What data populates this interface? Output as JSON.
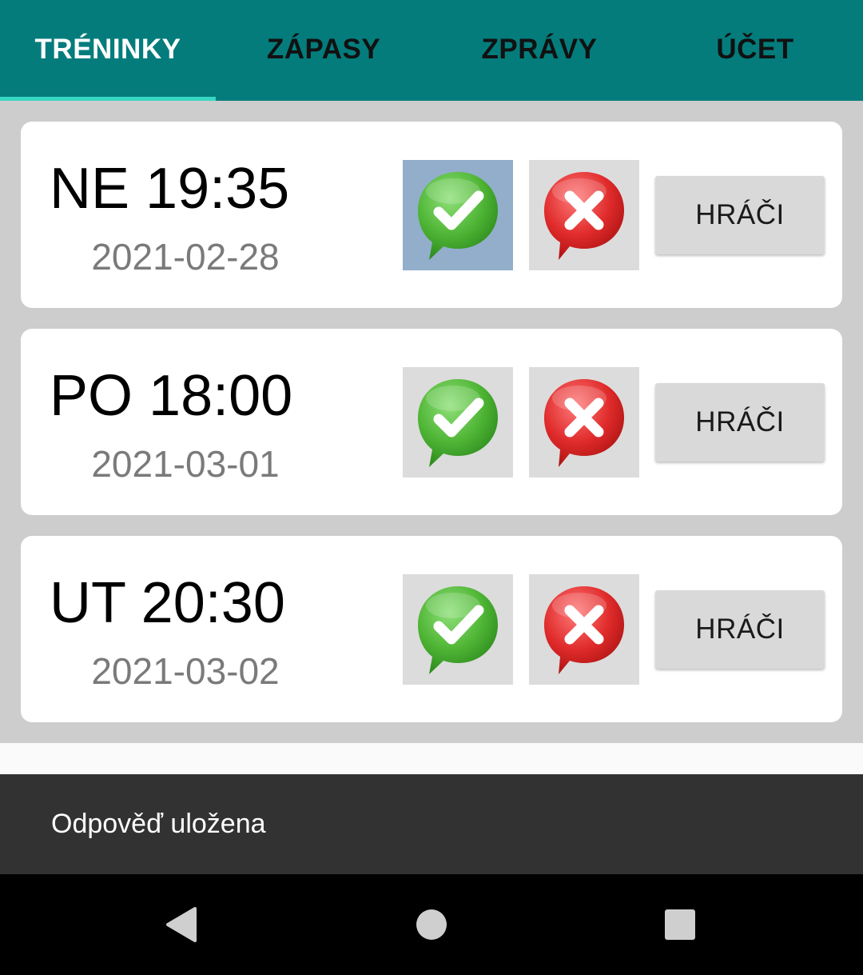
{
  "tabs": [
    {
      "label": "TRÉNINKY",
      "active": true
    },
    {
      "label": "ZÁPASY",
      "active": false
    },
    {
      "label": "ZPRÁVY",
      "active": false
    },
    {
      "label": "ÚČET",
      "active": false
    }
  ],
  "colors": {
    "tabbar": "#047c7c",
    "tab_indicator": "#36d6c1",
    "selected_vote": "#92aecb",
    "yes_icon": "#5cbf3c",
    "no_icon": "#e02b2b"
  },
  "trainings": [
    {
      "time": "NE 19:35",
      "date": "2021-02-28",
      "players_label": "HRÁČI",
      "response": "yes"
    },
    {
      "time": "PO 18:00",
      "date": "2021-03-01",
      "players_label": "HRÁČI",
      "response": "none"
    },
    {
      "time": "UT 20:30",
      "date": "2021-03-02",
      "players_label": "HRÁČI",
      "response": "none"
    }
  ],
  "icons": {
    "yes": "green-check-bubble-icon",
    "no": "red-x-bubble-icon",
    "nav_back": "back-triangle-icon",
    "nav_home": "home-circle-icon",
    "nav_recent": "recents-square-icon"
  },
  "snackbar": {
    "message": "Odpověď uložena"
  }
}
